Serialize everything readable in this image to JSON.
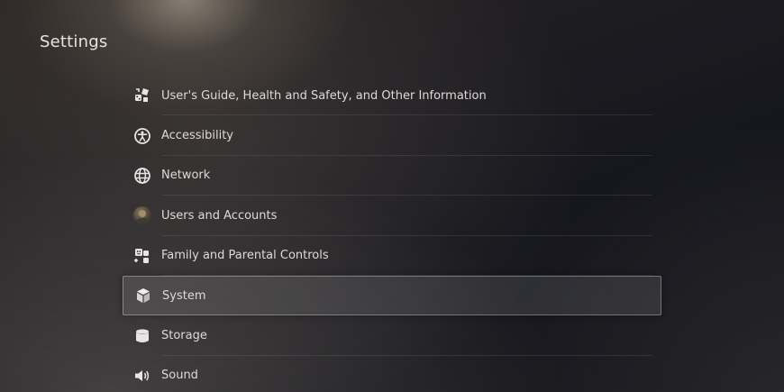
{
  "page": {
    "title": "Settings"
  },
  "menu": {
    "items": [
      {
        "label": "User's Guide, Health and Safety, and Other Information",
        "icon": "guide-icon"
      },
      {
        "label": "Accessibility",
        "icon": "accessibility-icon"
      },
      {
        "label": "Network",
        "icon": "globe-icon"
      },
      {
        "label": "Users and Accounts",
        "icon": "user-avatar"
      },
      {
        "label": "Family and Parental Controls",
        "icon": "family-controls-icon"
      },
      {
        "label": "System",
        "icon": "cube-icon",
        "selected": true
      },
      {
        "label": "Storage",
        "icon": "storage-icon"
      },
      {
        "label": "Sound",
        "icon": "speaker-icon"
      }
    ]
  },
  "colors": {
    "text": "#dddbd9",
    "highlight_border": "#8f8e90"
  }
}
